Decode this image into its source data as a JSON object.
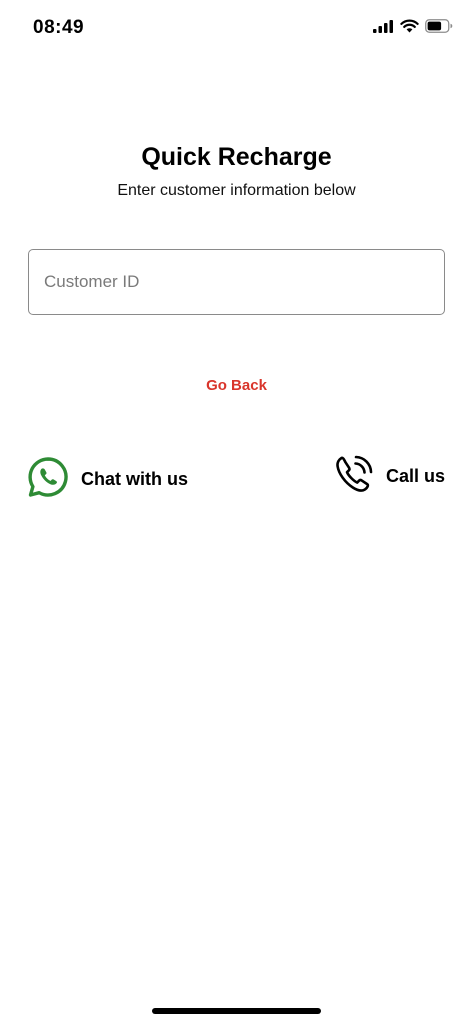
{
  "status_bar": {
    "time": "08:49",
    "icons": [
      "cellular-signal-icon",
      "wifi-icon",
      "battery-icon"
    ]
  },
  "header": {
    "title": "Quick Recharge",
    "subtitle": "Enter customer information below"
  },
  "form": {
    "customer_id_placeholder": "Customer ID",
    "customer_id_value": ""
  },
  "actions": {
    "go_back_label": "Go Back"
  },
  "contact": {
    "chat_label": "Chat with us",
    "chat_icon": "whatsapp-icon",
    "call_label": "Call us",
    "call_icon": "phone-call-icon"
  },
  "colors": {
    "accent_red": "#d9352b",
    "whatsapp_green": "#2e8b35",
    "text": "#000000"
  }
}
